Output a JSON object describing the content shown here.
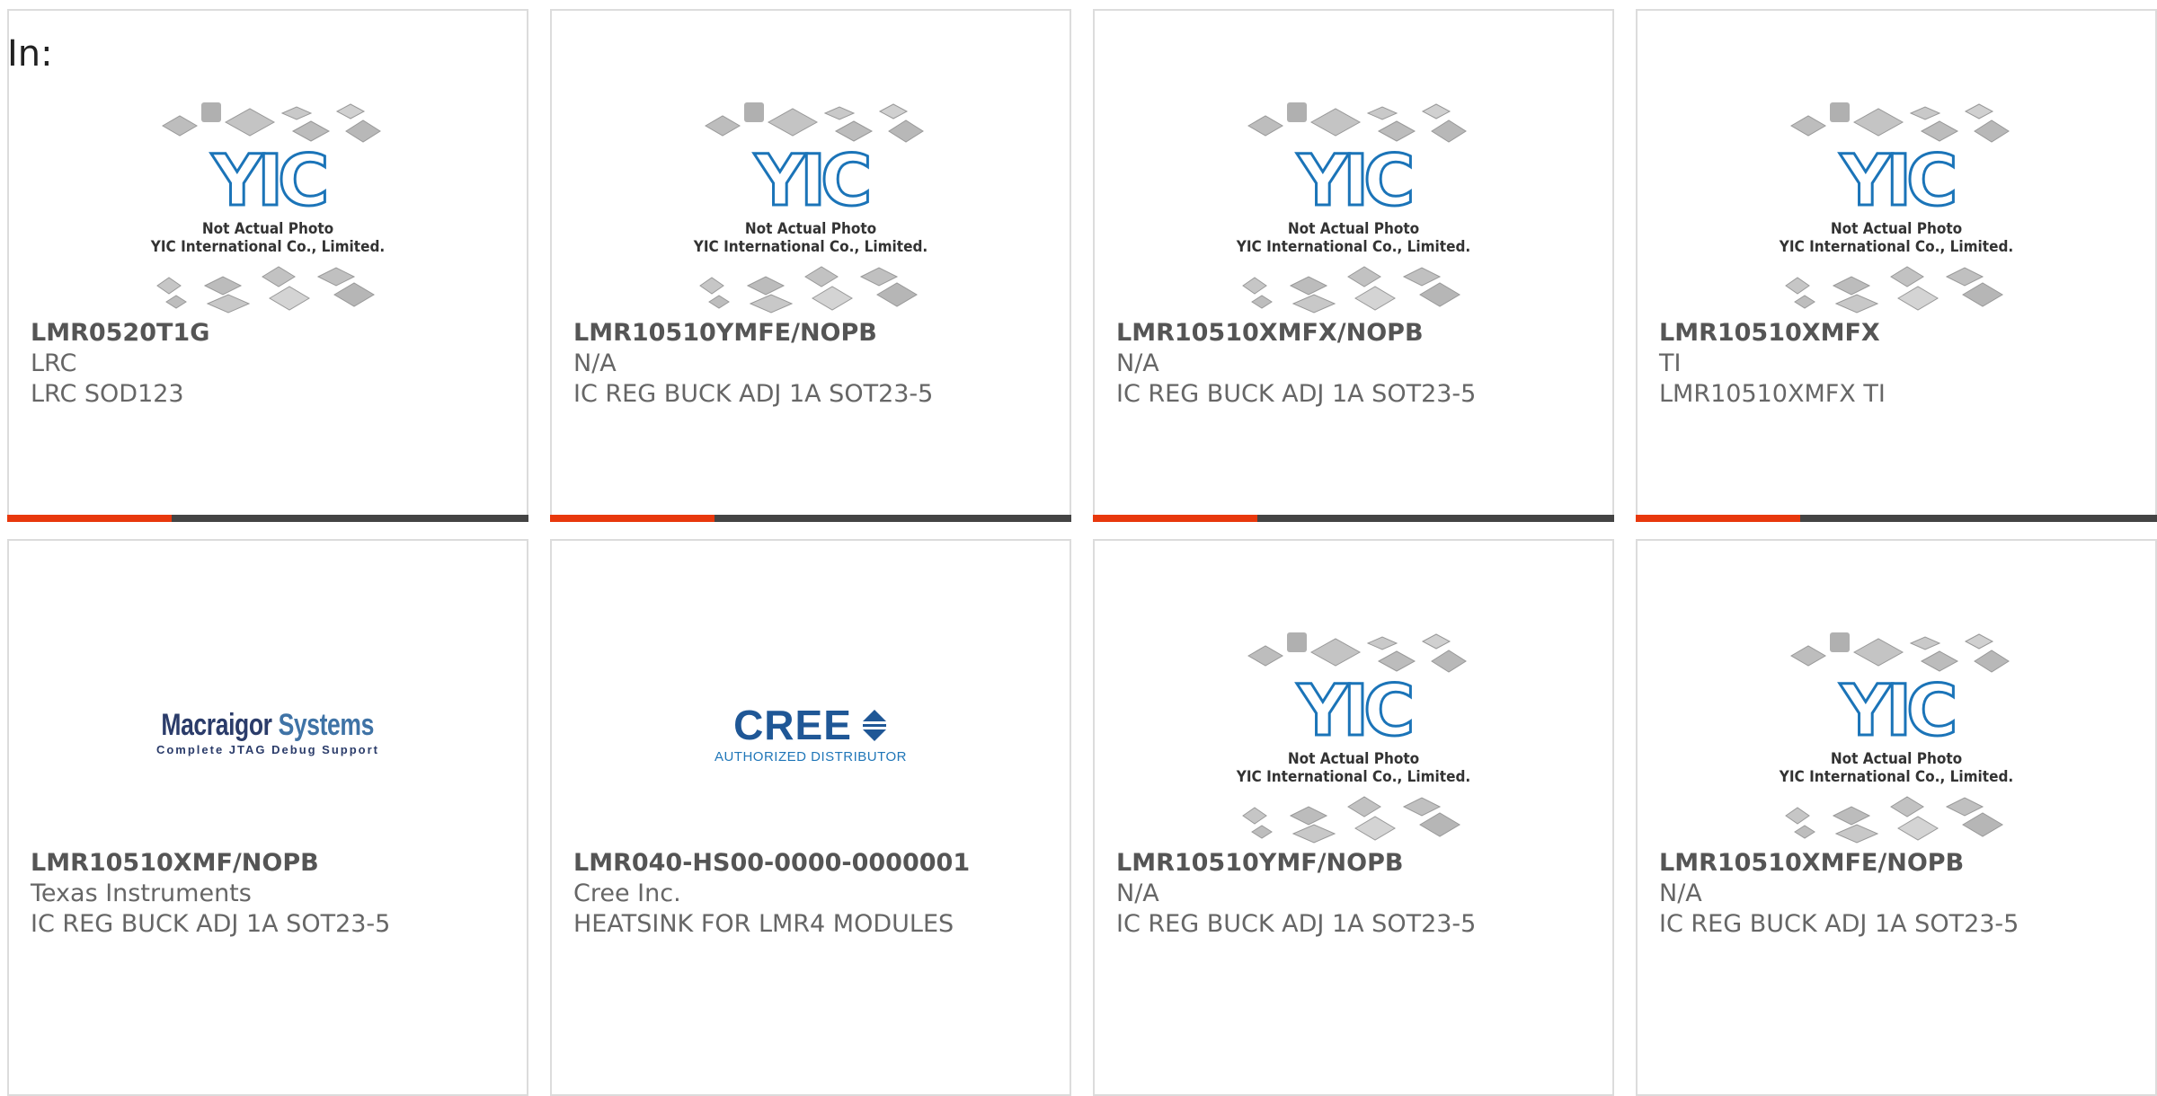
{
  "header": {
    "label": "In:"
  },
  "yic_placeholder": {
    "logo_text": "YIC",
    "line1": "Not Actual Photo",
    "line2": "YIC International Co., Limited."
  },
  "brands": {
    "macraigor": {
      "name": "Macraigor Systems",
      "word1": "Macraigor",
      "word2": "Systems",
      "tagline": "Complete JTAG Debug Support"
    },
    "cree": {
      "name": "CREE",
      "tagline": "AUTHORIZED DISTRIBUTOR"
    }
  },
  "products": [
    {
      "part": "LMR0520T1G",
      "manufacturer": "LRC",
      "description": "LRC SOD123",
      "image": "yic-placeholder"
    },
    {
      "part": "LMR10510YMFE/NOPB",
      "manufacturer": "N/A",
      "description": "IC REG BUCK ADJ 1A SOT23-5",
      "image": "yic-placeholder"
    },
    {
      "part": "LMR10510XMFX/NOPB",
      "manufacturer": "N/A",
      "description": "IC REG BUCK ADJ 1A SOT23-5",
      "image": "yic-placeholder"
    },
    {
      "part": "LMR10510XMFX",
      "manufacturer": "TI",
      "description": "LMR10510XMFX TI",
      "image": "yic-placeholder"
    },
    {
      "part": "LMR10510XMF/NOPB",
      "manufacturer": "Texas Instruments",
      "description": "IC REG BUCK ADJ 1A SOT23-5",
      "image": "macraigor-logo"
    },
    {
      "part": "LMR040-HS00-0000-0000001",
      "manufacturer": "Cree Inc.",
      "description": "HEATSINK FOR LMR4 MODULES",
      "image": "cree-logo"
    },
    {
      "part": "LMR10510YMF/NOPB",
      "manufacturer": "N/A",
      "description": "IC REG BUCK ADJ 1A SOT23-5",
      "image": "yic-placeholder"
    },
    {
      "part": "LMR10510XMFE/NOPB",
      "manufacturer": "N/A",
      "description": "IC REG BUCK ADJ 1A SOT23-5",
      "image": "yic-placeholder"
    }
  ],
  "colors": {
    "accent": "#e8380d",
    "bar": "#444444",
    "border": "#dcdcdc",
    "yic_blue": "#1b74b8"
  }
}
